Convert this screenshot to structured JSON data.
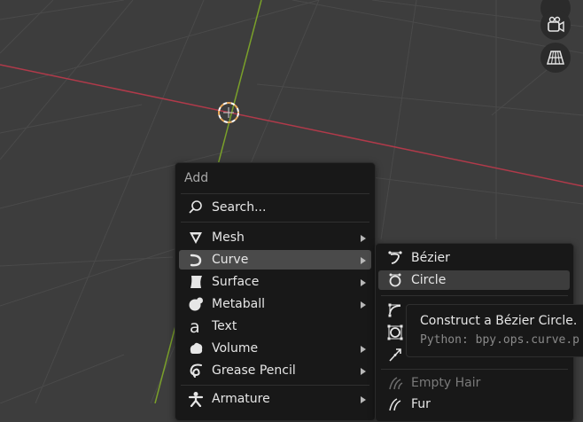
{
  "colors": {
    "background": "#3d3d3d",
    "grid_line": "#4a4a4a",
    "x_axis": "#b03a4a",
    "y_axis": "#7aa02a",
    "menu_bg": "#181818",
    "highlight": "#4a4a4a",
    "origin_marker": "#e8a85a"
  },
  "viewport_gizmos": [
    "camera-icon",
    "grid-perspective-icon"
  ],
  "add_menu": {
    "title": "Add",
    "search_label": "Search...",
    "items": [
      {
        "label": "Mesh",
        "icon": "mesh-icon",
        "submenu": true
      },
      {
        "label": "Curve",
        "icon": "curve-icon",
        "submenu": true,
        "highlighted": true
      },
      {
        "label": "Surface",
        "icon": "surface-icon",
        "submenu": true
      },
      {
        "label": "Metaball",
        "icon": "metaball-icon",
        "submenu": true
      },
      {
        "label": "Text",
        "icon": "text-icon",
        "submenu": false
      },
      {
        "label": "Volume",
        "icon": "volume-icon",
        "submenu": true
      },
      {
        "label": "Grease Pencil",
        "icon": "grease-pencil-icon",
        "submenu": true
      },
      {
        "label": "Armature",
        "icon": "armature-icon",
        "submenu": true
      }
    ]
  },
  "curve_submenu": {
    "items": [
      {
        "label": "Bézier",
        "icon": "bezier-icon"
      },
      {
        "label": "Circle",
        "icon": "circle-curve-icon",
        "active": true
      },
      {
        "label": "",
        "icon": "nurbs-curve-icon"
      },
      {
        "label": "",
        "icon": "nurbs-circle-icon"
      },
      {
        "label": "",
        "icon": "path-icon"
      },
      {
        "label": "Empty Hair",
        "icon": "hair-icon",
        "disabled": true
      },
      {
        "label": "Fur",
        "icon": "fur-icon"
      }
    ]
  },
  "tooltip": {
    "description": "Construct a Bézier Circle.",
    "python": "Python: bpy.ops.curve.p"
  }
}
